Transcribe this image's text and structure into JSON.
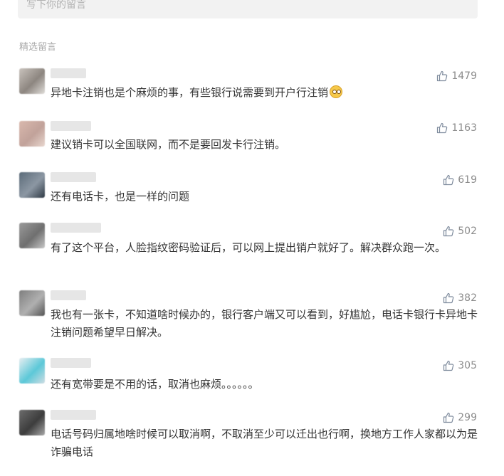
{
  "input": {
    "placeholder": "写下你的留言"
  },
  "section": {
    "title": "精选留言"
  },
  "comments": [
    {
      "likes": "1479",
      "text": "异地卡注销也是个麻烦的事，有些银行说需要到开户行注销",
      "has_emoji": true,
      "avatar_colors": [
        "#c9c3bd",
        "#8d8680",
        "#e0ddd9"
      ]
    },
    {
      "likes": "1163",
      "text": "建议销卡可以全国联网，而不是要回发卡行注销。",
      "has_emoji": false,
      "avatar_colors": [
        "#d9b8ad",
        "#c1a29a",
        "#e8d7cf"
      ]
    },
    {
      "likes": "619",
      "text": "还有电话卡，也是一样的问题",
      "has_emoji": false,
      "avatar_colors": [
        "#5b6b79",
        "#8c97a3",
        "#2f3a45"
      ]
    },
    {
      "likes": "502",
      "text": "有了这个平台，人脸指纹密码验证后，可以网上提出销户就好了。解决群众跑一次。",
      "has_emoji": false,
      "avatar_colors": [
        "#9a9a9a",
        "#6f6f6f",
        "#c7c7c7"
      ]
    },
    {
      "likes": "382",
      "text": "我也有一张卡，不知道啥时候办的，银行客户端又可以看到，好尴尬，电话卡银行卡异地卡注销问题希望早日解决。",
      "has_emoji": false,
      "avatar_colors": [
        "#7e7e7e",
        "#b0b0b0",
        "#545454"
      ]
    },
    {
      "likes": "305",
      "text": "还有宽带要是不用的话，取消也麻烦。。。。。。",
      "has_emoji": false,
      "avatar_colors": [
        "#e8eef1",
        "#5cc8d8",
        "#d0dde3"
      ]
    },
    {
      "likes": "299",
      "text": "电话号码归属地啥时候可以取消啊，不取消至少可以迁出也行啊，换地方工作人家都以为是诈骗电话",
      "has_emoji": false,
      "avatar_colors": [
        "#6c6c6c",
        "#3d3d3d",
        "#a9a9a9"
      ]
    }
  ],
  "colors": {
    "text": "#333333",
    "muted": "#8c8c8c",
    "input_bg": "#f2f2f2"
  }
}
